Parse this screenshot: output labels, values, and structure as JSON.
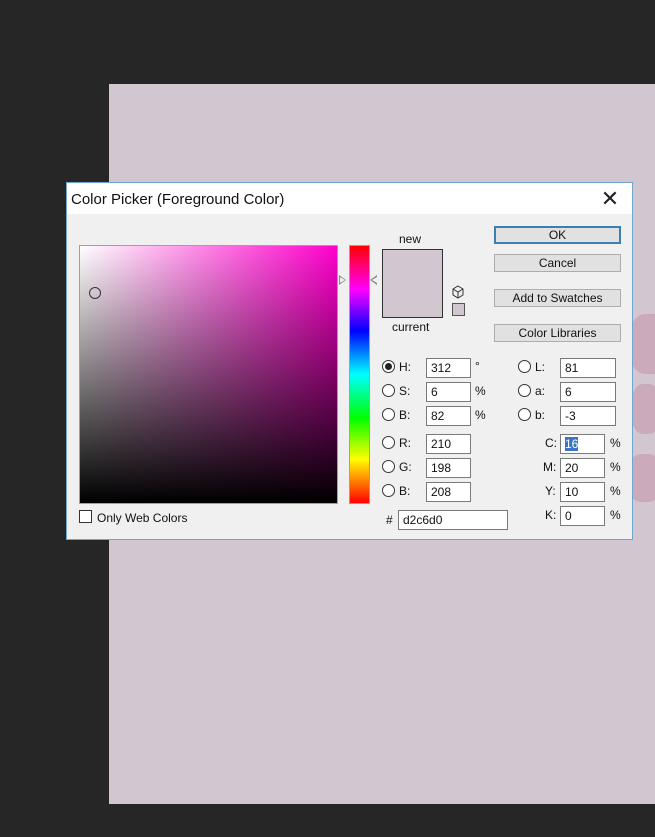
{
  "dialog": {
    "title": "Color Picker (Foreground Color)",
    "close_glyph": "✕"
  },
  "colors": {
    "new": "#d2c6d0",
    "current": "#d2c6d0",
    "document": "#d2c6d0",
    "hue_pure": "#ff00cc",
    "accent": "#3c7fb1"
  },
  "preview": {
    "new_label": "new",
    "current_label": "current"
  },
  "buttons": {
    "ok": "OK",
    "cancel": "Cancel",
    "add_to_swatches": "Add to Swatches",
    "color_libraries": "Color Libraries"
  },
  "hsb": {
    "h_label": "H:",
    "h_value": "312",
    "h_unit": "°",
    "s_label": "S:",
    "s_value": "6",
    "s_unit": "%",
    "b_label": "B:",
    "b_value": "82",
    "b_unit": "%",
    "selected": "H"
  },
  "rgb": {
    "r_label": "R:",
    "r_value": "210",
    "g_label": "G:",
    "g_value": "198",
    "b_label": "B:",
    "b_value": "208"
  },
  "lab": {
    "l_label": "L:",
    "l_value": "81",
    "a_label": "a:",
    "a_value": "6",
    "b_label": "b:",
    "b_value": "-3"
  },
  "cmyk": {
    "c_label": "C:",
    "c_value": "16",
    "c_unit": "%",
    "m_label": "M:",
    "m_value": "20",
    "m_unit": "%",
    "y_label": "Y:",
    "y_value": "10",
    "y_unit": "%",
    "k_label": "K:",
    "k_value": "0",
    "k_unit": "%"
  },
  "hex": {
    "label": "#",
    "value": "d2c6d0"
  },
  "web_colors": {
    "label": "Only Web Colors",
    "checked": false
  },
  "icons": {
    "out_of_gamut": "cube-icon",
    "close": "close-icon"
  }
}
